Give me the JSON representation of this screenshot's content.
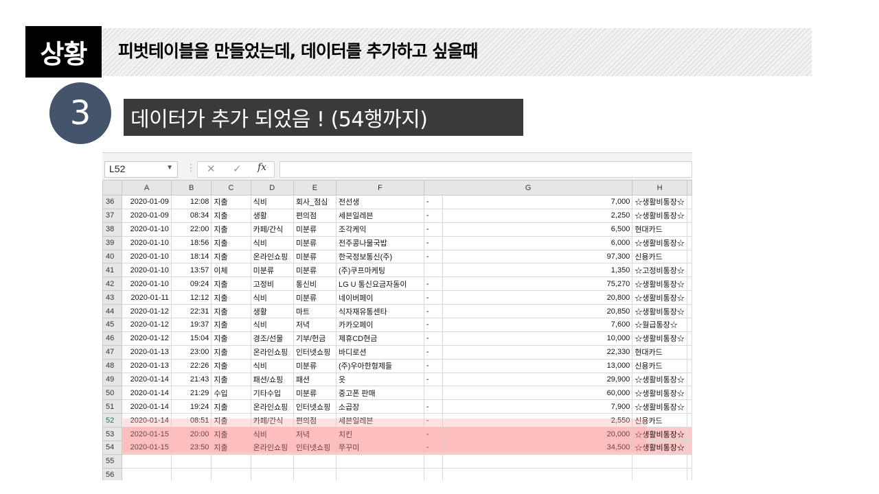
{
  "banner": {
    "situation_label": "상황",
    "headline": "피벗테이블을 만들었는데, 데이터를 추가하고 싶을때"
  },
  "step": {
    "number": "3",
    "text": "데이터가 추가 되었음 ! (54행까지)"
  },
  "excel": {
    "name_box": "L52",
    "formula_value": "",
    "columns": [
      "A",
      "B",
      "C",
      "D",
      "E",
      "F",
      "",
      "G",
      "H"
    ],
    "rows": [
      {
        "row": "36",
        "date": "2020-01-09",
        "time": "12:08",
        "type": "지출",
        "cat": "식비",
        "sub": "회사_점심",
        "desc": "전선생",
        "dash": "-",
        "amount": "7,000",
        "account": "☆생활비통장☆"
      },
      {
        "row": "37",
        "date": "2020-01-09",
        "time": "08:34",
        "type": "지출",
        "cat": "생활",
        "sub": "편의점",
        "desc": "세븐일레븐",
        "dash": "-",
        "amount": "2,250",
        "account": "☆생활비통장☆"
      },
      {
        "row": "38",
        "date": "2020-01-10",
        "time": "22:00",
        "type": "지출",
        "cat": "카페/간식",
        "sub": "미분류",
        "desc": "조각케익",
        "dash": "-",
        "amount": "6,500",
        "account": "현대카드"
      },
      {
        "row": "39",
        "date": "2020-01-10",
        "time": "18:56",
        "type": "지출",
        "cat": "식비",
        "sub": "미분류",
        "desc": "전주콩나물국밥",
        "dash": "-",
        "amount": "6,000",
        "account": "☆생활비통장☆"
      },
      {
        "row": "40",
        "date": "2020-01-10",
        "time": "18:14",
        "type": "지출",
        "cat": "온라인쇼핑",
        "sub": "미분류",
        "desc": "한국정보통신(주)",
        "dash": "-",
        "amount": "97,300",
        "account": "신용카드"
      },
      {
        "row": "41",
        "date": "2020-01-10",
        "time": "13:57",
        "type": "이체",
        "cat": "미분류",
        "sub": "미분류",
        "desc": "(주)쿠프마케팅",
        "dash": "",
        "amount": "1,350",
        "account": "☆고정비통장☆"
      },
      {
        "row": "42",
        "date": "2020-01-10",
        "time": "09:24",
        "type": "지출",
        "cat": "고정비",
        "sub": "통신비",
        "desc": "LG U 통신요금자동이",
        "dash": "-",
        "amount": "75,270",
        "account": "☆생활비통장☆"
      },
      {
        "row": "43",
        "date": "2020-01-11",
        "time": "12:12",
        "type": "지출",
        "cat": "식비",
        "sub": "미분류",
        "desc": "네이버페이",
        "dash": "-",
        "amount": "20,800",
        "account": "☆생활비통장☆"
      },
      {
        "row": "44",
        "date": "2020-01-12",
        "time": "22:31",
        "type": "지출",
        "cat": "생활",
        "sub": "마트",
        "desc": "식자재유통센타",
        "dash": "-",
        "amount": "20,850",
        "account": "☆생활비통장☆"
      },
      {
        "row": "45",
        "date": "2020-01-12",
        "time": "19:37",
        "type": "지출",
        "cat": "식비",
        "sub": "저녁",
        "desc": "카카오페이",
        "dash": "-",
        "amount": "7,600",
        "account": "☆월급통장☆"
      },
      {
        "row": "46",
        "date": "2020-01-12",
        "time": "15:04",
        "type": "지출",
        "cat": "경조/선물",
        "sub": "기부/헌금",
        "desc": "제휴CD현금",
        "dash": "-",
        "amount": "10,000",
        "account": "☆생활비통장☆"
      },
      {
        "row": "47",
        "date": "2020-01-13",
        "time": "23:00",
        "type": "지출",
        "cat": "온라인쇼핑",
        "sub": "인터넷쇼핑",
        "desc": "바디로션",
        "dash": "-",
        "amount": "22,330",
        "account": "현대카드"
      },
      {
        "row": "48",
        "date": "2020-01-13",
        "time": "22:26",
        "type": "지출",
        "cat": "식비",
        "sub": "미분류",
        "desc": "(주)우아한형제들",
        "dash": "-",
        "amount": "13,000",
        "account": "신용카드"
      },
      {
        "row": "49",
        "date": "2020-01-14",
        "time": "21:43",
        "type": "지출",
        "cat": "패션/쇼핑",
        "sub": "패션",
        "desc": "옷",
        "dash": "-",
        "amount": "29,900",
        "account": "☆생활비통장☆"
      },
      {
        "row": "50",
        "date": "2020-01-14",
        "time": "21:29",
        "type": "수입",
        "cat": "기타수입",
        "sub": "미분류",
        "desc": "중고폰 판매",
        "dash": "",
        "amount": "60,000",
        "account": "☆생활비통장☆"
      },
      {
        "row": "51",
        "date": "2020-01-14",
        "time": "19:24",
        "type": "지출",
        "cat": "온라인쇼핑",
        "sub": "인터넷쇼핑",
        "desc": "소곱장",
        "dash": "-",
        "amount": "7,900",
        "account": "☆생활비통장☆"
      },
      {
        "row": "52",
        "date": "2020-01-14",
        "time": "08:51",
        "type": "지출",
        "cat": "카페/간식",
        "sub": "편의점",
        "desc": "세븐일레븐",
        "dash": "-",
        "amount": "2,550",
        "account": "신용카드"
      },
      {
        "row": "53",
        "date": "2020-01-15",
        "time": "20:00",
        "type": "지출",
        "cat": "식비",
        "sub": "저녁",
        "desc": "치킨",
        "dash": "-",
        "amount": "20,000",
        "account": "☆생활비통장☆"
      },
      {
        "row": "54",
        "date": "2020-01-15",
        "time": "23:50",
        "type": "지출",
        "cat": "온라인쇼핑",
        "sub": "인터넷쇼핑",
        "desc": "쭈꾸미",
        "dash": "-",
        "amount": "34,500",
        "account": "☆생활비통장☆"
      },
      {
        "row": "55",
        "date": "",
        "time": "",
        "type": "",
        "cat": "",
        "sub": "",
        "desc": "",
        "dash": "",
        "amount": "",
        "account": ""
      },
      {
        "row": "56",
        "date": "",
        "time": "",
        "type": "",
        "cat": "",
        "sub": "",
        "desc": "",
        "dash": "",
        "amount": "",
        "account": ""
      }
    ],
    "highlighted_rows": [
      "53",
      "54"
    ],
    "selected_row": "52",
    "highlight_color": "#ffc9c9"
  }
}
